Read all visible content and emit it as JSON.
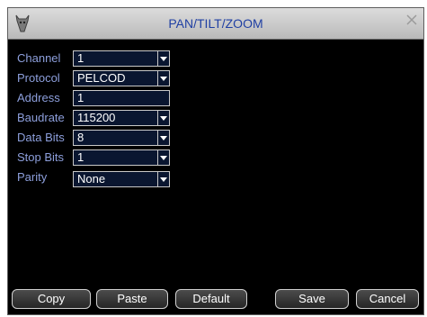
{
  "window": {
    "title": "PAN/TILT/ZOOM"
  },
  "fields": [
    {
      "label": "Channel",
      "value": "1",
      "type": "dropdown"
    },
    {
      "label": "Protocol",
      "value": "PELCOD",
      "type": "dropdown"
    },
    {
      "label": "Address",
      "value": "1",
      "type": "text"
    },
    {
      "label": "Baudrate",
      "value": "115200",
      "type": "dropdown"
    },
    {
      "label": "Data Bits",
      "value": "8",
      "type": "dropdown"
    },
    {
      "label": "Stop Bits",
      "value": "1",
      "type": "dropdown"
    },
    {
      "label": "Parity",
      "value": "None",
      "type": "dropdown"
    }
  ],
  "buttons": {
    "copy": "Copy",
    "paste": "Paste",
    "default": "Default",
    "save": "Save",
    "cancel": "Cancel"
  },
  "icons": {
    "logo": "bull-head-icon",
    "close": "close-icon"
  },
  "colors": {
    "label": "#8d9fdc",
    "title": "#1f3fa3",
    "background": "#000000",
    "field": "#0a1630"
  }
}
